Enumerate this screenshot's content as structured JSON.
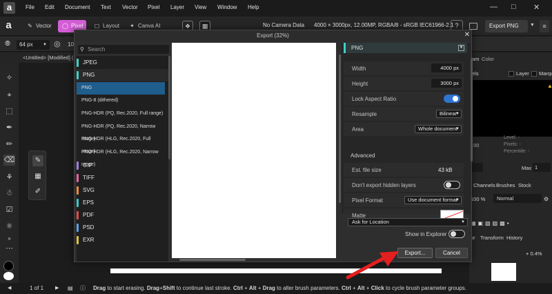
{
  "app": {
    "logo": "a"
  },
  "menu": [
    "File",
    "Edit",
    "Document",
    "Text",
    "Vector",
    "Pixel",
    "Layer",
    "View",
    "Window",
    "Help"
  ],
  "personas": [
    {
      "label": "Vector",
      "icon": "vector-persona-icon"
    },
    {
      "label": "Pixel",
      "icon": "pixel-persona-icon"
    },
    {
      "label": "Layout",
      "icon": "layout-persona-icon"
    },
    {
      "label": "Canva AI",
      "icon": "canva-ai-icon"
    }
  ],
  "document_info": {
    "camera": "No Camera Data",
    "details": "4000 × 3000px, 12.00MP, RGBA/8 - sRGB IEC61966-2.1"
  },
  "toolbar": {
    "export_label": "Export PNG"
  },
  "context": {
    "brush_size": "64 px",
    "partial_value": "10"
  },
  "document_tab": "<Untitled> [Modified] (2",
  "dialog": {
    "title": "Export (32%)",
    "search_placeholder": "Search",
    "formats": [
      {
        "label": "JPEG",
        "color": "#3ed2c9"
      },
      {
        "label": "PNG",
        "color": "#3ed2c9"
      }
    ],
    "png_variants": [
      "PNG",
      "PNG-8 (dithered)",
      "PNG-HDR (PQ, Rec.2020, Full range)",
      "PNG-HDR (PQ, Rec.2020, Narrow range)",
      "PNG-HDR (HLG, Rec.2020, Full range)",
      "PNG-HDR (HLG, Rec.2020, Narrow range)"
    ],
    "other_formats": [
      {
        "label": "GIF",
        "color": "#9b7fe0"
      },
      {
        "label": "TIFF",
        "color": "#e4649c"
      },
      {
        "label": "SVG",
        "color": "#f08a3c"
      },
      {
        "label": "EPS",
        "color": "#3cc9c9"
      },
      {
        "label": "PDF",
        "color": "#e24a4a"
      },
      {
        "label": "PSD",
        "color": "#5ea0e8"
      },
      {
        "label": "EXR",
        "color": "#e0c43c"
      }
    ],
    "settings": {
      "section": "PNG",
      "width_label": "Width",
      "width_value": "4000 px",
      "height_label": "Height",
      "height_value": "3000 px",
      "lock_label": "Lock Aspect Ratio",
      "lock_on": true,
      "resample_label": "Resample",
      "resample_value": "Bilinear",
      "area_label": "Area",
      "area_value": "Whole document",
      "advanced_label": "Advanced",
      "filesize_label": "Est. file size",
      "filesize_value": "43 kB",
      "hidden_label": "Don't export hidden layers",
      "hidden_on": false,
      "pixelformat_label": "Pixel Format",
      "pixelformat_value": "Use document format",
      "matte_label": "Matte"
    },
    "location_value": "Ask for Location",
    "show_in_explorer_label": "Show in Explorer",
    "show_in_explorer_on": false,
    "export_button": "Export...",
    "cancel_button": "Cancel"
  },
  "right_panel": {
    "tabs_top": [
      "am",
      "Color"
    ],
    "partial_tab": "els",
    "layer_label": "Layer",
    "marquee_label": "Marqu",
    "value_00": ".00",
    "level_label": "Level: -",
    "pixels_label": "Pixels: -",
    "percentile_label": "Percentile: -",
    "max_label": "Max",
    "max_value": "1",
    "tabs_mid": [
      "Channels",
      "Brushes",
      "Stock"
    ],
    "opacity": "100 %",
    "blend_mode": "Normal",
    "tabs_low": [
      "or",
      "Transform",
      "History"
    ],
    "zoom_value": "+ 0.4%"
  },
  "status": {
    "page": "1 of 1",
    "hint_parts": [
      {
        "t": "Drag",
        "b": true
      },
      {
        "t": " to start erasing. ",
        "b": false
      },
      {
        "t": "Drag",
        "b": true
      },
      {
        "t": "+",
        "b": false
      },
      {
        "t": "Shift",
        "b": true
      },
      {
        "t": " to continue last stroke. ",
        "b": false
      },
      {
        "t": "Ctrl",
        "b": true
      },
      {
        "t": " + ",
        "b": false
      },
      {
        "t": "Alt",
        "b": true
      },
      {
        "t": " + ",
        "b": false
      },
      {
        "t": "Drag",
        "b": true
      },
      {
        "t": " to alter brush parameters. ",
        "b": false
      },
      {
        "t": "Ctrl",
        "b": true
      },
      {
        "t": " + ",
        "b": false
      },
      {
        "t": "Alt",
        "b": true
      },
      {
        "t": " + ",
        "b": false
      },
      {
        "t": "Click",
        "b": true
      },
      {
        "t": " to cycle brush parameter groups.",
        "b": false
      }
    ]
  }
}
